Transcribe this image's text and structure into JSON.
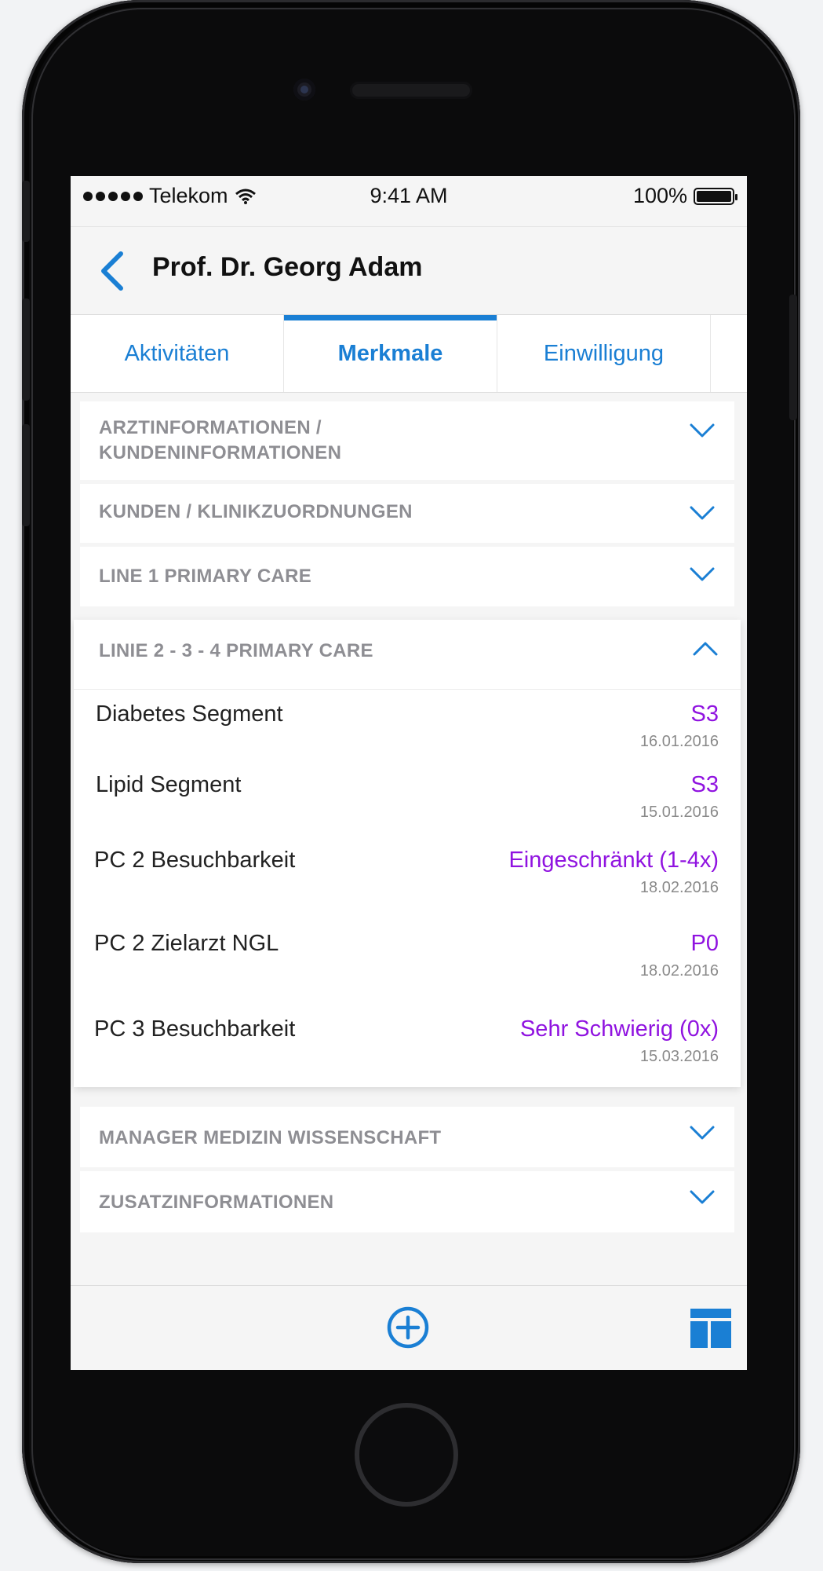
{
  "status_bar": {
    "carrier": "Telekom",
    "time": "9:41 AM",
    "battery": "100%"
  },
  "nav": {
    "title": "Prof. Dr. Georg Adam",
    "back_icon": "chevron-left-icon"
  },
  "tabs": [
    {
      "label": "Aktivitäten",
      "active": false
    },
    {
      "label": "Merkmale",
      "active": true
    },
    {
      "label": "Einwilligung",
      "active": false
    }
  ],
  "sections_top": [
    {
      "label": "ARZTINFORMATIONEN / KUNDENINFORMATIONEN"
    },
    {
      "label": "KUNDEN / KLINIKZUORDNUNGEN"
    },
    {
      "label": "LINE 1 PRIMARY CARE"
    }
  ],
  "expanded_section": {
    "label": "LINIE 2 - 3 - 4 PRIMARY CARE",
    "rows": [
      {
        "label": "Diabetes Segment",
        "value": "S3",
        "date": "16.01.2016"
      },
      {
        "label": "Lipid Segment",
        "value": "S3",
        "date": "15.01.2016"
      },
      {
        "label": "PC 2 Besuchbarkeit",
        "value": "Eingeschränkt (1-4x)",
        "date": "18.02.2016"
      },
      {
        "label": "PC 2 Zielarzt NGL",
        "value": "P0",
        "date": "18.02.2016"
      },
      {
        "label": "PC 3 Besuchbarkeit",
        "value": "Sehr Schwierig (0x)",
        "date": "15.03.2016"
      }
    ]
  },
  "sections_bottom": [
    {
      "label": "MANAGER MEDIZIN WISSENSCHAFT"
    },
    {
      "label": "ZUSATZINFORMATIONEN"
    }
  ],
  "toolbar": {
    "add_icon": "plus-circle-icon",
    "layout_icon": "layout-grid-icon"
  },
  "colors": {
    "accent": "#1a7fd4",
    "value": "#9013e0",
    "section_label": "#8e8e93"
  }
}
